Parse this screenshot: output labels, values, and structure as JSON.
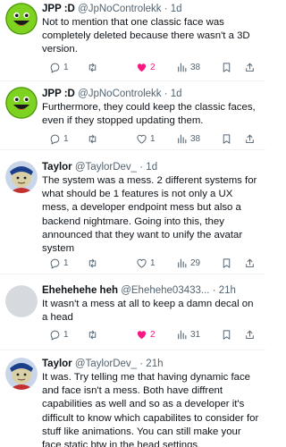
{
  "tweets": [
    {
      "name": "JPP :D",
      "handle": "@JpNoControlekk",
      "time": "· 1d",
      "text": "Not to mention that one classic face was completely deleted because there wasn't a 3D version.",
      "replies": "1",
      "retweets": "",
      "likes": "2",
      "views": "38",
      "liked": true
    },
    {
      "name": "JPP :D",
      "handle": "@JpNoControlekk",
      "time": "· 1d",
      "text": "Furthermore, they could keep the classic faces, even if they stopped updating them.",
      "replies": "1",
      "retweets": "",
      "likes": "1",
      "views": "38",
      "liked": false
    },
    {
      "name": "Taylor",
      "handle": "@TaylorDev_",
      "time": "· 1d",
      "text": "The system was a mess. 2 different systems for what should be 1 features is not only a UX mess, a developer endpoint mess but also a backend nightmare. Going into this, they announced that they want to unify the avatar system",
      "replies": "1",
      "retweets": "",
      "likes": "1",
      "views": "29",
      "liked": false
    },
    {
      "name": "Ehehehehe heh",
      "handle": "@Ehehehe03433...",
      "time": "· 21h",
      "text": "It wasn't a mess at all to keep a damn decal on a head",
      "replies": "1",
      "retweets": "",
      "likes": "2",
      "views": "31",
      "liked": true
    },
    {
      "name": "Taylor",
      "handle": "@TaylorDev_",
      "time": "· 21h",
      "text": "It was. Try telling me that having dynamic face and face isn't a mess. Both have diffrent capabilities as well and so as a developer it's difficult to know which capabilites to consider for stuff like animations. You can still make your face static btw in the head settings.",
      "replies": "",
      "retweets": "",
      "likes": "",
      "views": "",
      "liked": false
    }
  ],
  "colors": {
    "liked": "#f91880",
    "muted": "#536471",
    "text": "#0f1419",
    "divider": "#eff3f4"
  },
  "icons": [
    "reply-icon",
    "retweet-icon",
    "like-icon",
    "views-icon",
    "bookmark-icon",
    "share-icon"
  ]
}
